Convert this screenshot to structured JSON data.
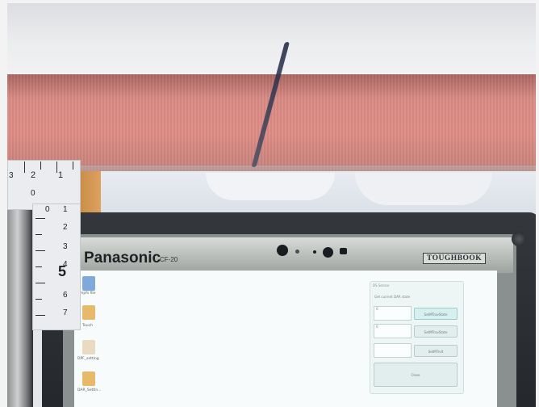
{
  "laptop": {
    "brand": "Panasonic",
    "model": "CF-20",
    "series_badge": "TOUGHBOOK"
  },
  "desktop": {
    "icons": [
      {
        "name": "blue-doc-icon",
        "label": "mpfs file",
        "color": "#7fa9d8"
      },
      {
        "name": "folder-icon",
        "label": "Touch",
        "color": "#e7b96a"
      },
      {
        "name": "file-icon",
        "label": "DPF_setting",
        "color": "#e9dbc1"
      },
      {
        "name": "folder-icon",
        "label": "DAR_SettIn...",
        "color": "#e7b96a"
      }
    ]
  },
  "dialog": {
    "title": "DS Sensor",
    "row_label": "Get current DAR state",
    "field_1": "0",
    "field_2": "0",
    "btn_1": "SetMTravState",
    "btn_2": "SetMTravState",
    "btn_3": "SetMTrvlt",
    "close": "Close"
  },
  "ruler": {
    "top_numbers": [
      "3",
      "2",
      "1",
      "0"
    ],
    "side_numbers": [
      "0",
      "1",
      "2",
      "3",
      "4",
      "5",
      "6",
      "7"
    ],
    "big_mark": "5"
  }
}
